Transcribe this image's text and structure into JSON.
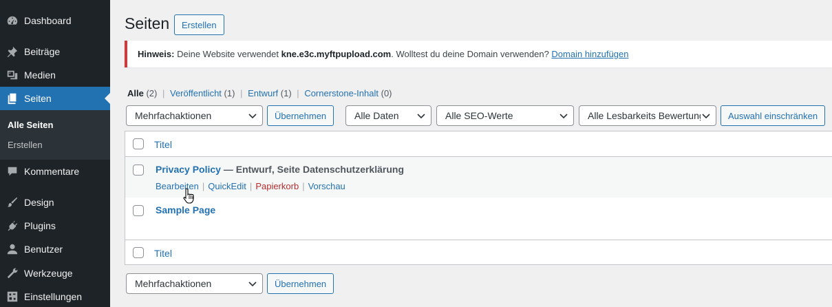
{
  "sidebar": {
    "items": [
      {
        "label": "Dashboard",
        "icon": "dashboard-icon"
      },
      {
        "label": "Beiträge",
        "icon": "pin-icon"
      },
      {
        "label": "Medien",
        "icon": "media-icon"
      },
      {
        "label": "Seiten",
        "icon": "pages-icon"
      },
      {
        "label": "Kommentare",
        "icon": "comment-icon"
      },
      {
        "label": "Design",
        "icon": "brush-icon"
      },
      {
        "label": "Plugins",
        "icon": "plugin-icon"
      },
      {
        "label": "Benutzer",
        "icon": "user-icon"
      },
      {
        "label": "Werkzeuge",
        "icon": "wrench-icon"
      },
      {
        "label": "Einstellungen",
        "icon": "settings-icon"
      }
    ],
    "submenu": [
      "Alle Seiten",
      "Erstellen"
    ]
  },
  "header": {
    "title": "Seiten",
    "create_label": "Erstellen"
  },
  "notice": {
    "prefix": "Hinweis:",
    "text1": " Deine Website verwendet ",
    "domain": "kne.e3c.myftpupload.com",
    "text2": ". Wolltest du deine Domain verwenden? ",
    "link": "Domain hinzufügen"
  },
  "filters": {
    "views": [
      {
        "label": "Alle",
        "count": "(2)"
      },
      {
        "label": "Veröffentlicht",
        "count": "(1)"
      },
      {
        "label": "Entwurf",
        "count": "(1)"
      },
      {
        "label": "Cornerstone-Inhalt",
        "count": "(0)"
      }
    ],
    "bulk_action": "Mehrfachaktionen",
    "apply_label": "Übernehmen",
    "dates": "Alle Daten",
    "seo": "Alle SEO-Werte",
    "readability": "Alle Lesbarkeits Bewertungen",
    "filter_label": "Auswahl einschränken"
  },
  "table": {
    "column_title": "Titel",
    "rows": [
      {
        "title": "Privacy Policy",
        "state": " — Entwurf, Seite Datenschutzerklärung",
        "actions": [
          "Bearbeiten",
          "QuickEdit",
          "Papierkorb",
          "Vorschau"
        ]
      },
      {
        "title": "Sample Page",
        "state": ""
      }
    ]
  },
  "colors": {
    "sidebar_bg": "#1d2327",
    "accent": "#2271b1",
    "notice_border": "#d63638",
    "trash": "#b32d2e"
  }
}
